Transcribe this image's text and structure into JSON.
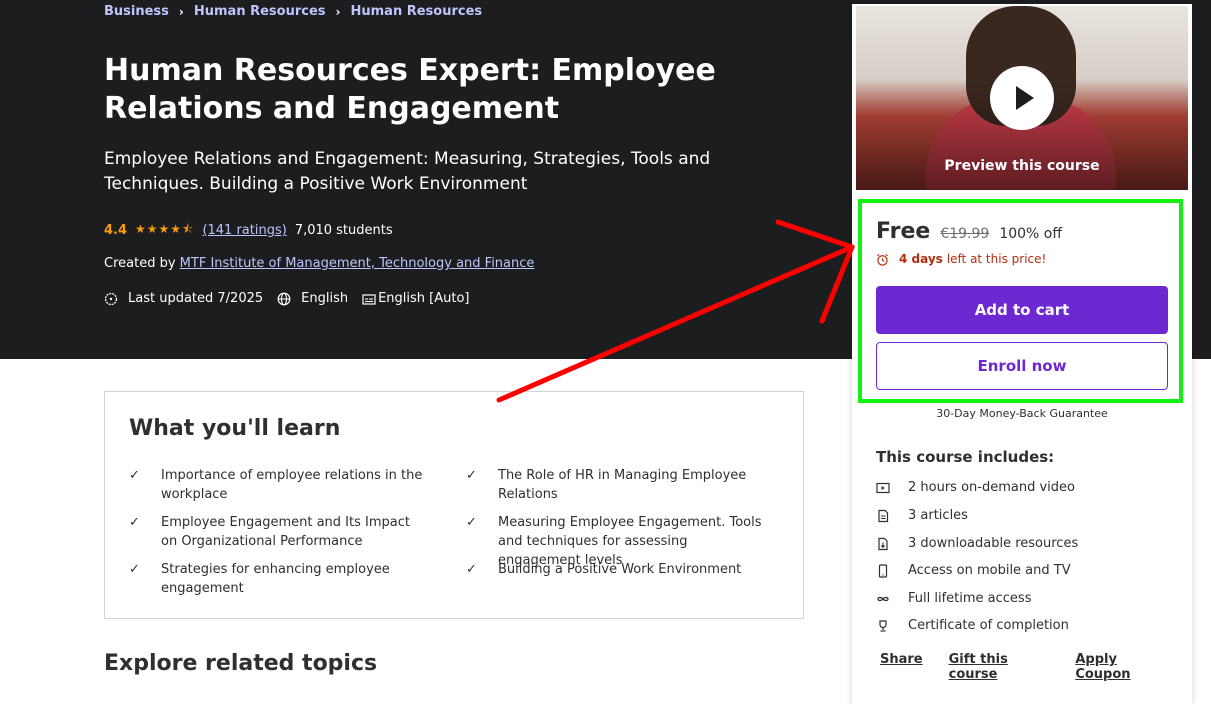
{
  "breadcrumb": [
    "Business",
    "Human Resources",
    "Human Resources"
  ],
  "course": {
    "title": "Human Resources Expert: Employee Relations and Engagement",
    "subtitle": "Employee Relations and Engagement: Measuring, Strategies, Tools and Techniques. Building a Positive Work Environment",
    "rating": "4.4",
    "stars_value": 4.4,
    "ratings_link": "(141 ratings)",
    "students": "7,010 students",
    "created_by_label": "Created by",
    "creator": "MTF Institute of Management, Technology and Finance",
    "last_updated": "Last updated 7/2025",
    "language": "English",
    "captions": "English [Auto]"
  },
  "learn": {
    "heading": "What you'll learn",
    "items": [
      "Importance of employee relations in the workplace",
      "The Role of HR in Managing Employee Relations",
      "Employee Engagement and Its Impact on Organizational Performance",
      "Measuring Employee Engagement. Tools and techniques for assessing engagement levels",
      "Strategies for enhancing employee engagement",
      "Building a Positive Work Environment"
    ]
  },
  "related_heading": "Explore related topics",
  "sidebar": {
    "preview_label": "Preview this course",
    "price": "Free",
    "old_price": "€19.99",
    "discount": "100% off",
    "timer_bold": "4 days",
    "timer_rest": "left at this price!",
    "add_to_cart": "Add to cart",
    "enroll_now": "Enroll now",
    "guarantee": "30-Day Money-Back Guarantee",
    "includes_title": "This course includes:",
    "includes": [
      {
        "icon": "video-icon",
        "text": "2 hours on-demand video"
      },
      {
        "icon": "article-icon",
        "text": "3 articles"
      },
      {
        "icon": "download-icon",
        "text": "3 downloadable resources"
      },
      {
        "icon": "mobile-icon",
        "text": "Access on mobile and TV"
      },
      {
        "icon": "infinity-icon",
        "text": "Full lifetime access"
      },
      {
        "icon": "trophy-icon",
        "text": "Certificate of completion"
      }
    ],
    "links": [
      "Share",
      "Gift this course",
      "Apply Coupon"
    ]
  },
  "colors": {
    "hero_bg": "#1c1d1f",
    "accent_purple": "#6d28d2",
    "star_orange": "#f69c08",
    "timer_red": "#b32d0f",
    "highlight_green": "#13f113",
    "annotation_arrow": "#ff0000"
  }
}
